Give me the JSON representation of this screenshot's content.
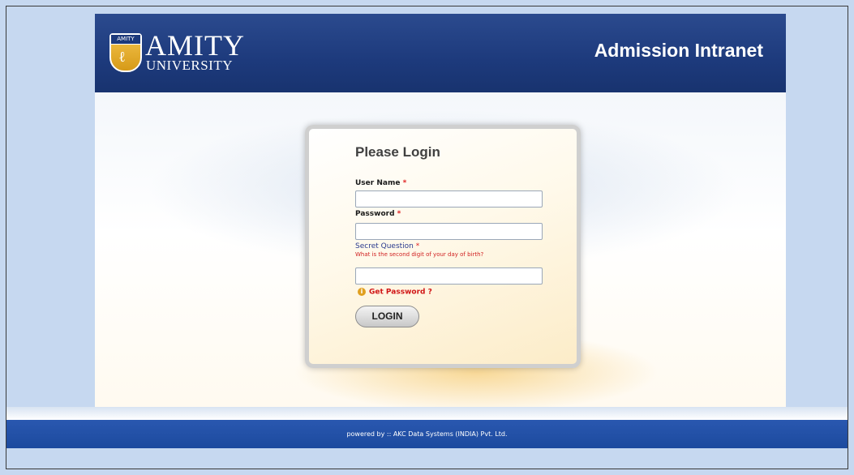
{
  "header": {
    "logo_name": "AMITY",
    "logo_sub": "UNIVERSITY",
    "logo_band": "AMITY",
    "title": "Admission Intranet"
  },
  "login": {
    "title": "Please Login",
    "username_label": "User Name",
    "password_label": "Password",
    "secret_label": "Secret Question",
    "required_mark": "*",
    "secret_question": "What is the second digit of your day of birth?",
    "username_value": "",
    "password_value": "",
    "secret_value": "",
    "get_password": "Get Password ?",
    "login_button": "LOGIN"
  },
  "footer": {
    "text": "powered by :: AKC Data Systems (INDIA) Pvt. Ltd."
  },
  "colors": {
    "header_blue": "#1d3a7c",
    "required_red": "#e02020",
    "link_red": "#d01515",
    "label_blue": "#2a3a8e"
  },
  "icons": [
    "info-icon",
    "amity-shield-logo"
  ]
}
